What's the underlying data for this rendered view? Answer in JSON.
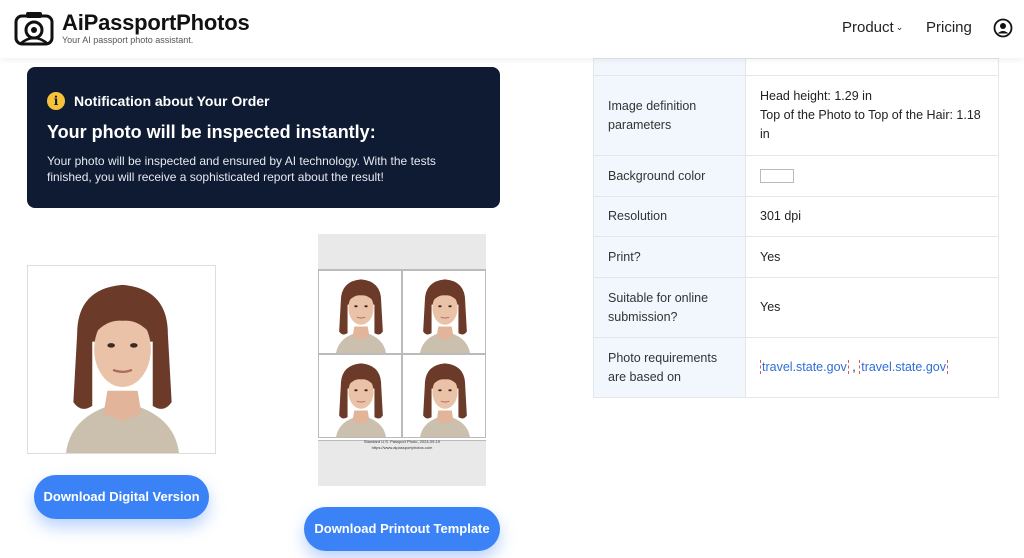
{
  "header": {
    "brand": "AiPassportPhotos",
    "tagline": "Your AI passport photo assistant.",
    "nav": {
      "product": "Product",
      "pricing": "Pricing"
    }
  },
  "notice": {
    "title": "Notification about Your Order",
    "heading": "Your photo will be inspected instantly:",
    "body": "Your photo will be inspected and ensured by AI technology. With the tests finished, you will receive a sophisticated report about the result!"
  },
  "template": {
    "caption_line1": "Standard U.S. Passport Photo, 2024-09-19",
    "caption_line2": "https://www.aipassportphotos.com"
  },
  "buttons": {
    "download_digital": "Download Digital Version",
    "download_print": "Download Printout Template"
  },
  "specs": {
    "definition_label": "Image definition parameters",
    "definition_line1": "Head height: 1.29 in",
    "definition_line2": "Top of the Photo to Top of the Hair: 1.18 in",
    "background_label": "Background color",
    "background_color": "#ffffff",
    "resolution_label": "Resolution",
    "resolution_value": "301 dpi",
    "print_label": "Print?",
    "print_value": "Yes",
    "online_label": "Suitable for online submission?",
    "online_value": "Yes",
    "requirements_label": "Photo requirements are based on",
    "link1": "travel.state.gov",
    "link_sep": ",",
    "link2": "travel.state.gov"
  },
  "colors": {
    "accent": "#3b82f6",
    "notice_bg": "#0f1b33",
    "info_icon": "#f5c23a"
  }
}
